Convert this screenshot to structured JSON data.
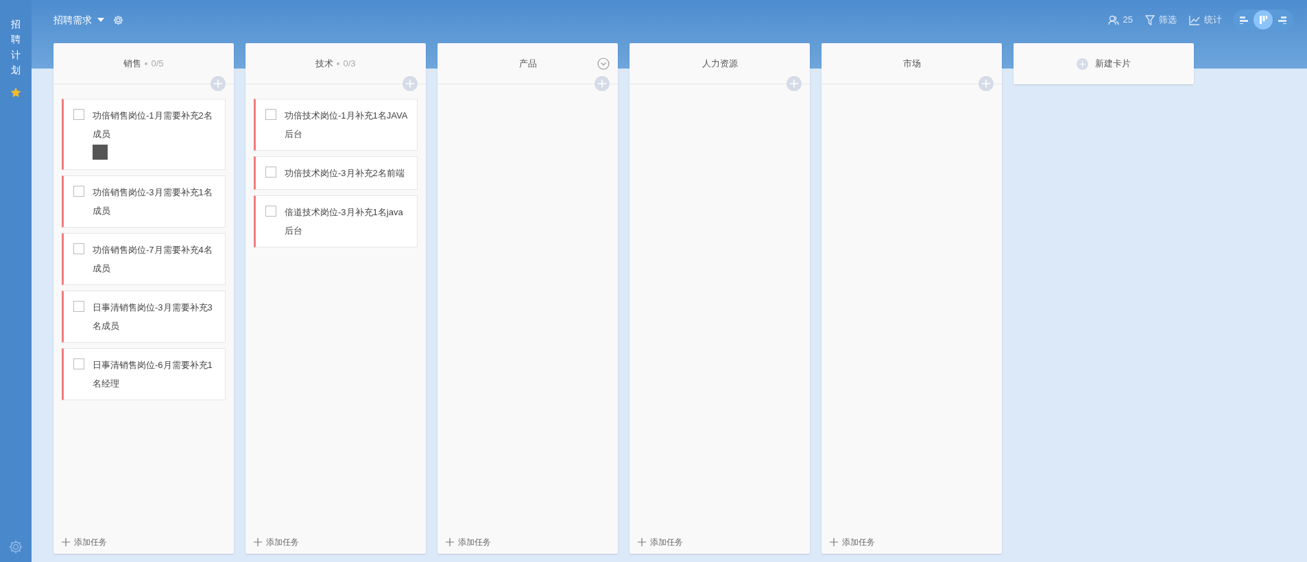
{
  "sidebar": {
    "title": "招聘计划",
    "starred": true
  },
  "header": {
    "board_title": "招聘需求",
    "members": "25",
    "filter": "筛选",
    "stats": "统计",
    "view_modes": [
      {
        "kind": "gantt",
        "selected": false
      },
      {
        "kind": "board",
        "selected": true
      },
      {
        "kind": "list",
        "selected": false
      }
    ]
  },
  "columns": [
    {
      "name": "销售",
      "count": "0/5",
      "show_menu": false,
      "add_task": "添加任务",
      "cards": [
        {
          "title": "功倍销售岗位-1月需要补充2名成员",
          "checked": false,
          "avatar": true
        },
        {
          "title": "功倍销售岗位-3月需要补充1名成员",
          "checked": false,
          "avatar": false
        },
        {
          "title": "功倍销售岗位-7月需要补充4名成员",
          "checked": false,
          "avatar": false
        },
        {
          "title": "日事清销售岗位-3月需要补充3名成员",
          "checked": false,
          "avatar": false
        },
        {
          "title": "日事清销售岗位-6月需要补充1名经理",
          "checked": false,
          "avatar": false
        }
      ]
    },
    {
      "name": "技术",
      "count": "0/3",
      "show_menu": false,
      "add_task": "添加任务",
      "cards": [
        {
          "title": "功倍技术岗位-1月补充1名JAVA后台",
          "checked": false,
          "avatar": false
        },
        {
          "title": "功倍技术岗位-3月补充2名前端",
          "checked": false,
          "avatar": false
        },
        {
          "title": "倍道技术岗位-3月补充1名java后台",
          "checked": false,
          "avatar": false
        }
      ]
    },
    {
      "name": "产品",
      "show_menu": true,
      "add_task": "添加任务"
    },
    {
      "name": "人力资源",
      "show_menu": false,
      "add_task": "添加任务"
    },
    {
      "name": "市场",
      "show_menu": false,
      "add_task": "添加任务"
    }
  ],
  "new_card": "新建卡片"
}
